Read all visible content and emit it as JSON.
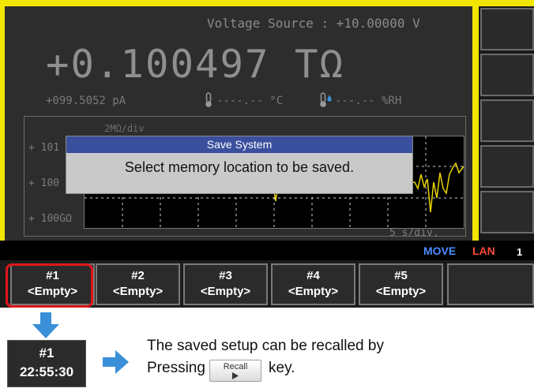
{
  "screen": {
    "voltage_source": "Voltage Source : +10.00000  V",
    "main_value": "+0.100497 TΩ",
    "current": "+099.5052 pA",
    "temperature": "----.-- °C",
    "humidity": "---.-- %RH",
    "graph": {
      "scale_label": "2MΩ/div",
      "y_labels": [
        "+ 101",
        "+ 100",
        "+ 100GΩ"
      ],
      "time_div": "5 s/div."
    }
  },
  "dialog": {
    "title": "Save System",
    "message": "Select memory location to be saved."
  },
  "status": {
    "move": "MOVE",
    "lan": "LAN",
    "number": "1",
    "colors": {
      "move": "#4c8cff",
      "lan": "#ff4a3a"
    }
  },
  "softkeys": [
    {
      "num": "#1",
      "label": "<Empty>"
    },
    {
      "num": "#2",
      "label": "<Empty>"
    },
    {
      "num": "#3",
      "label": "<Empty>"
    },
    {
      "num": "#4",
      "label": "<Empty>"
    },
    {
      "num": "#5",
      "label": "<Empty>"
    }
  ],
  "result": {
    "num": "#1",
    "time": "22:55:30"
  },
  "note": {
    "line1": "The saved setup can be recalled by",
    "line2_prefix": "Pressing",
    "recall_key": "Recall",
    "line2_suffix": "key."
  },
  "icons": [
    "thermometer-icon",
    "humidity-icon",
    "arrow-down-icon",
    "arrow-right-icon",
    "play-icon"
  ],
  "colors": {
    "accent_blue": "#3a8fd8",
    "highlight_red": "#e0161b",
    "screen_yellow": "#f2e600",
    "dialog_title": "#3a4f9e"
  }
}
